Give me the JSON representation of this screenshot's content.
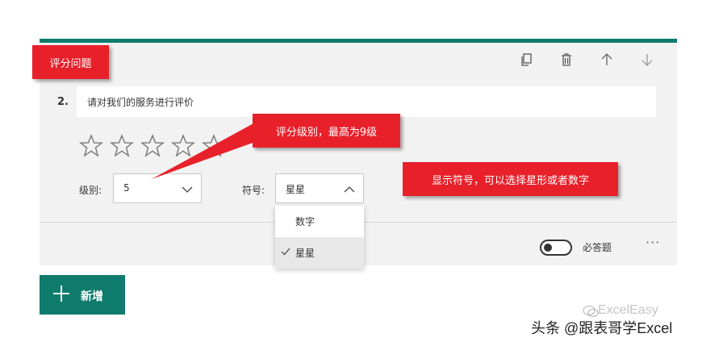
{
  "question": {
    "number": "2.",
    "text": "请对我们的服务进行评价",
    "rating_stars_visible": 5
  },
  "toolbar": {
    "icons": [
      "copy-icon",
      "delete-icon",
      "move-up-icon",
      "move-down-icon"
    ]
  },
  "settings": {
    "level_label": "级别:",
    "level_value": "5",
    "symbol_label": "符号:",
    "symbol_value": "星星"
  },
  "dropdown": {
    "options": [
      "数字",
      "星星"
    ],
    "selected": "星星"
  },
  "footer": {
    "required_label": "必答题",
    "required_on": false,
    "more_label": "···"
  },
  "add_button": {
    "label": "新增"
  },
  "annotations": {
    "title": "评分问题",
    "level_note": "评分级别，最高为9级",
    "symbol_note": "显示符号，可以选择星形或者数字"
  },
  "watermarks": {
    "brand": "ExcelEasy",
    "source": "头条 @跟表哥学Excel"
  },
  "colors": {
    "accent": "#0f7b6c",
    "callout": "#e8202a",
    "card_bg": "#f2f2f2"
  }
}
